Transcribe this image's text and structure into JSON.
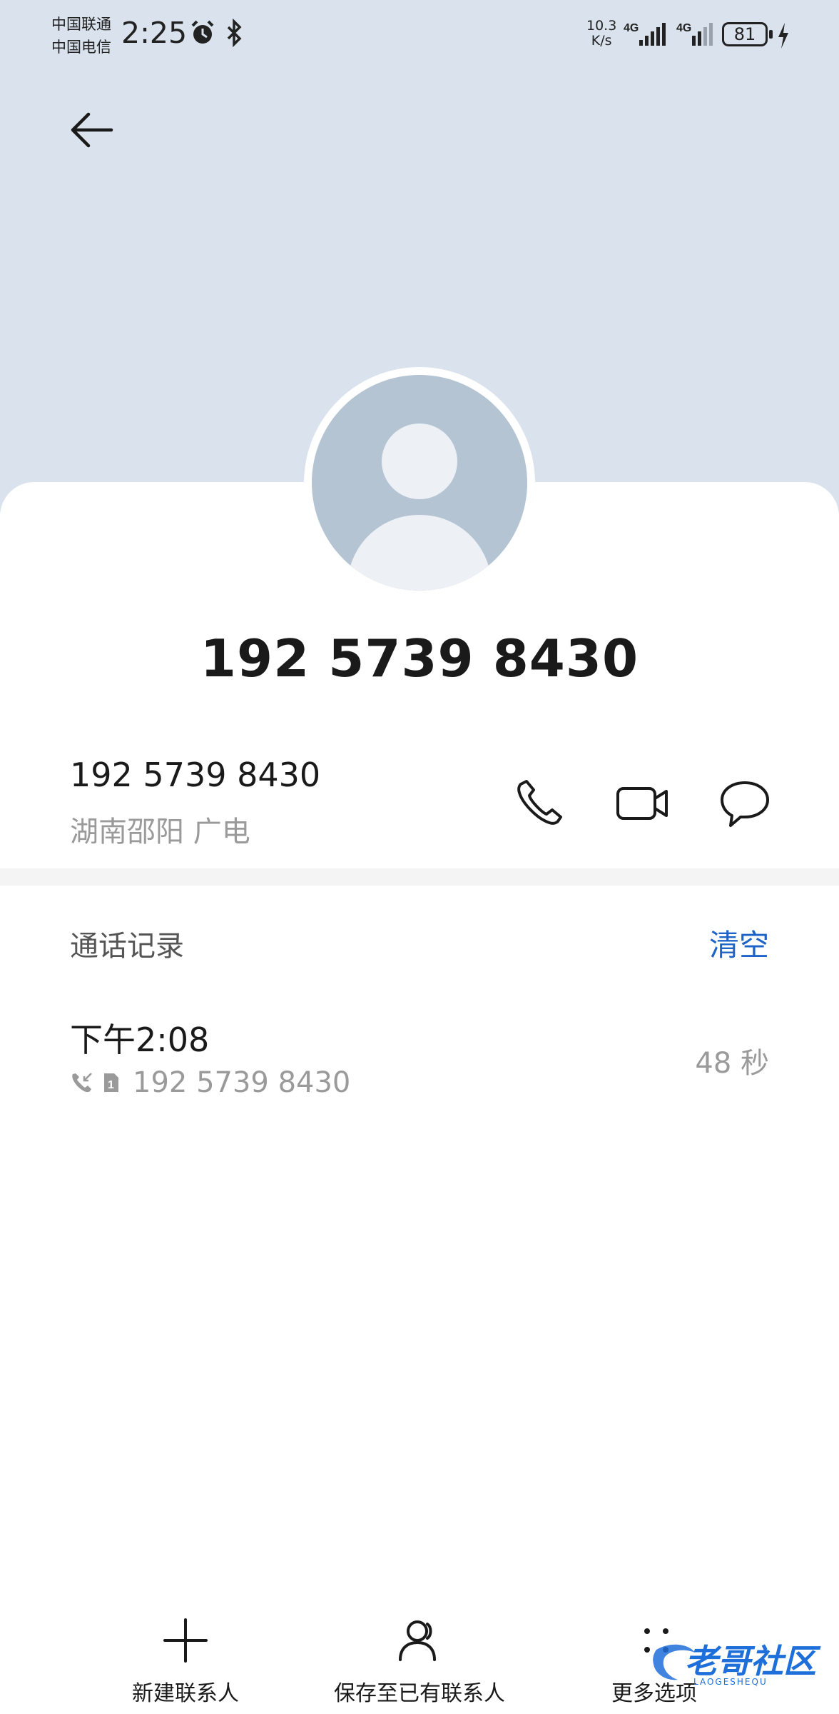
{
  "status_bar": {
    "carrier_1": "中国联通",
    "carrier_2": "中国电信",
    "time": "2:25",
    "speed_value": "10.3",
    "speed_unit": "K/s",
    "net_1": "4G",
    "net_2": "4G",
    "battery": "81"
  },
  "contact": {
    "name": "192 5739 8430",
    "number": "192 5739 8430",
    "location": "湖南邵阳 广电"
  },
  "call_log": {
    "title": "通话记录",
    "clear_label": "清空",
    "items": [
      {
        "time": "下午2:08",
        "number": "192 5739 8430",
        "duration": "48 秒",
        "sim": "1"
      }
    ]
  },
  "bottom_bar": {
    "new_contact": "新建联系人",
    "save_existing": "保存至已有联系人",
    "more_options": "更多选项"
  },
  "watermark": {
    "text": "老哥社区",
    "sub": "LAOGESHEQU"
  },
  "colors": {
    "header_bg": "#dae3ed",
    "accent": "#1e63c7",
    "secondary_text": "#9a9a9a"
  }
}
